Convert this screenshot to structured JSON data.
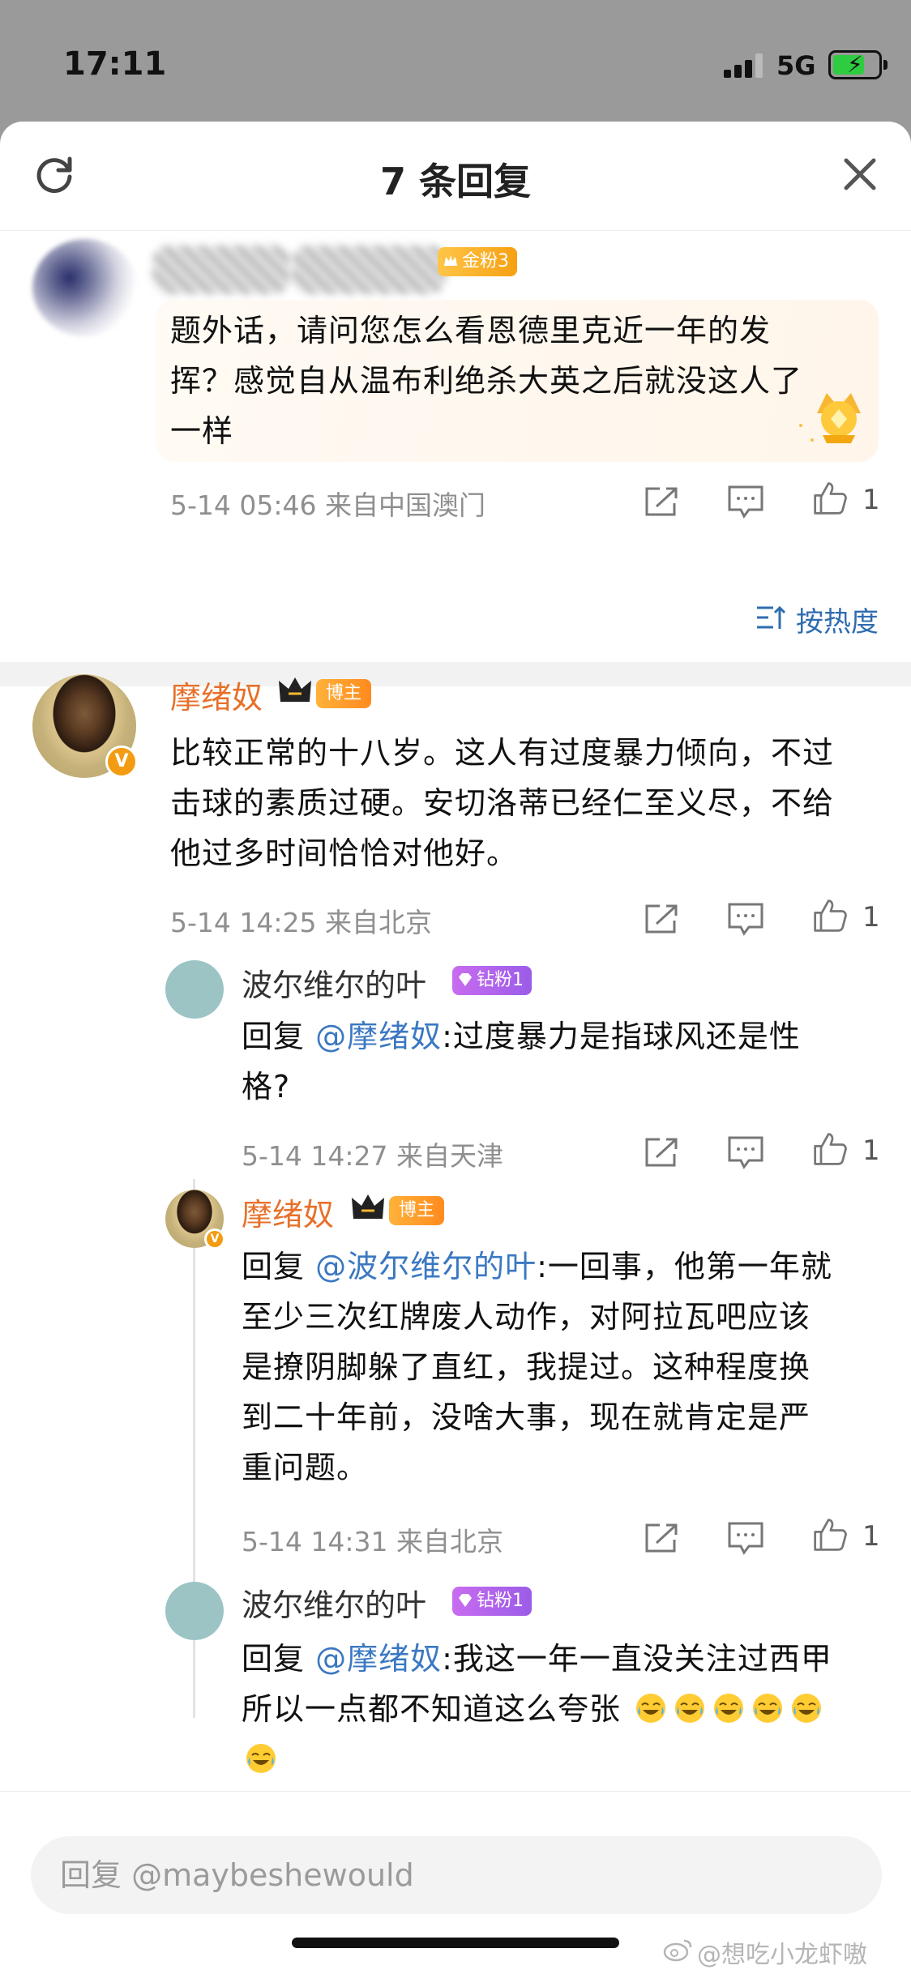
{
  "status": {
    "time": "17:11",
    "network": "5G"
  },
  "header": {
    "title": "7 条回复"
  },
  "root": {
    "badge": "金粉3",
    "text_lines": [
      "题外话，请问您怎么看恩德里克近一年的发",
      "挥？感觉自从温布利绝杀大英之后就没这人了",
      "一样"
    ],
    "meta": "5-14 05:46  来自中国澳门",
    "likes": "1"
  },
  "sort": {
    "label": "按热度"
  },
  "comments": [
    {
      "name": "摩绪奴",
      "badge": "博主",
      "text_lines": [
        "比较正常的十八岁。这人有过度暴力倾向，不过",
        "击球的素质过硬。安切洛蒂已经仁至义尽，不给",
        "他过多时间恰恰对他好。"
      ],
      "meta": "5-14 14:25  来自北京",
      "likes": "1"
    },
    {
      "name": "波尔维尔的叶",
      "badge": "钻粉1",
      "reply_prefix": "回复 ",
      "mention": "@摩绪奴",
      "text_first": ":过度暴力是指球风还是性",
      "text_lines": [
        "格?"
      ],
      "meta": "5-14 14:27  来自天津",
      "likes": "1"
    },
    {
      "name": "摩绪奴",
      "badge": "博主",
      "reply_prefix": "回复 ",
      "mention": "@波尔维尔的叶",
      "text_first": ":一回事，他第一年就",
      "text_lines": [
        "至少三次红牌废人动作，对阿拉瓦吧应该",
        "是撩阴脚躲了直红，我提过。这种程度换",
        "到二十年前，没啥大事，现在就肯定是严",
        "重问题。"
      ],
      "meta": "5-14 14:31  来自北京",
      "likes": "1"
    },
    {
      "name": "波尔维尔的叶",
      "badge": "钻粉1",
      "reply_prefix": "回复 ",
      "mention": "@摩绪奴",
      "text_first": ":我这一年一直没关注过西甲",
      "text_lines": [
        "所以一点都不知道这么夸张"
      ]
    }
  ],
  "input": {
    "placeholder": "回复 @maybeshewould"
  },
  "watermark": "@想吃小龙虾嗷"
}
